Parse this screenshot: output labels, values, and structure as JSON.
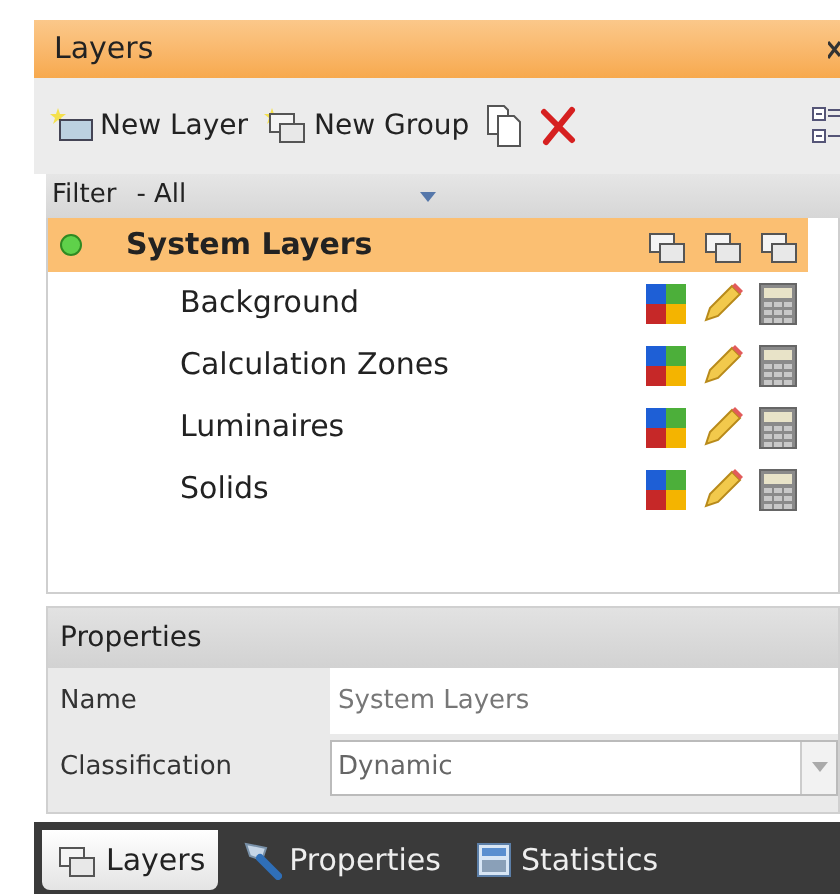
{
  "window": {
    "title": "Layers"
  },
  "toolbar": [
    {
      "kind": "new-layer",
      "label": "New Layer"
    },
    {
      "kind": "new-group",
      "label": "New Group"
    },
    {
      "kind": "copy"
    },
    {
      "kind": "delete"
    }
  ],
  "filter": {
    "label": "Filter",
    "value": "- All"
  },
  "tree": {
    "name": "System Layers",
    "selected": true,
    "children": [
      {
        "name": "Background"
      },
      {
        "name": "Calculation Zones"
      },
      {
        "name": "Luminaires"
      },
      {
        "name": "Solids"
      }
    ]
  },
  "properties": {
    "title": "Properties",
    "rows": [
      {
        "kind": "text",
        "label": "Name",
        "value": "System Layers"
      },
      {
        "kind": "dropdown",
        "label": "Classification",
        "value": "Dynamic"
      }
    ]
  },
  "tabs": [
    {
      "label": "Layers",
      "kind": "layers",
      "selected": true
    },
    {
      "label": "Properties",
      "kind": "properties",
      "selected": false
    },
    {
      "label": "Statistics",
      "kind": "statistics",
      "selected": false
    }
  ]
}
